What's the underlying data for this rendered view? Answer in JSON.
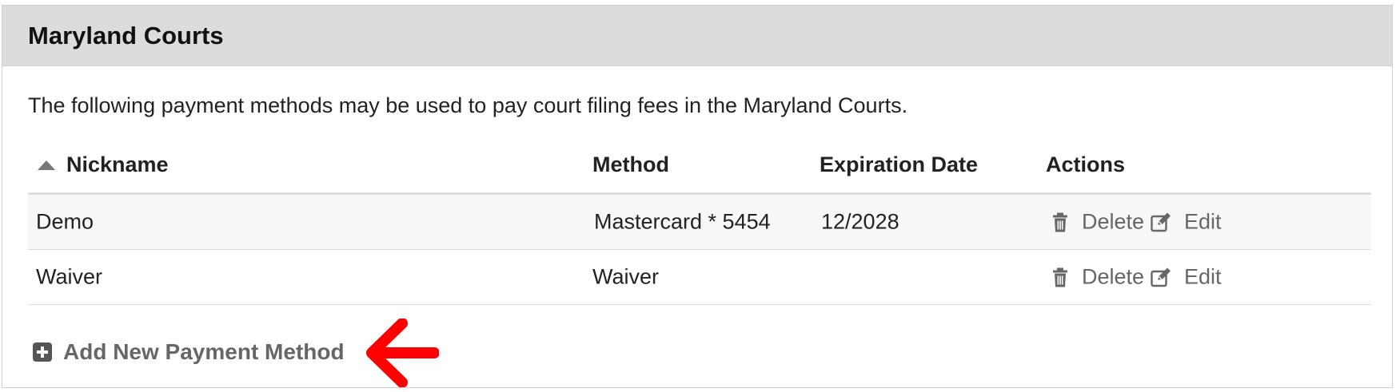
{
  "panel": {
    "title": "Maryland Courts",
    "intro": "The following payment methods may be used to pay court filing fees in the Maryland Courts."
  },
  "table": {
    "headers": {
      "nickname": "Nickname",
      "method": "Method",
      "expiration": "Expiration Date",
      "actions": "Actions"
    },
    "sort": "ascending",
    "rows": [
      {
        "nickname": "Demo",
        "method": "Mastercard * 5454",
        "expiration": "12/2028",
        "delete_label": "Delete",
        "edit_label": "Edit"
      },
      {
        "nickname": "Waiver",
        "method": "Waiver",
        "expiration": "",
        "delete_label": "Delete",
        "edit_label": "Edit"
      }
    ]
  },
  "add_payment": {
    "label": "Add New Payment Method",
    "icon": "plus-square-icon"
  },
  "annotation": {
    "icon": "red-arrow-icon",
    "color": "#ff0000"
  },
  "colors": {
    "header_bg": "#dcdcdc",
    "action_text": "#666666",
    "row_alt_bg": "#f7f7f7"
  }
}
